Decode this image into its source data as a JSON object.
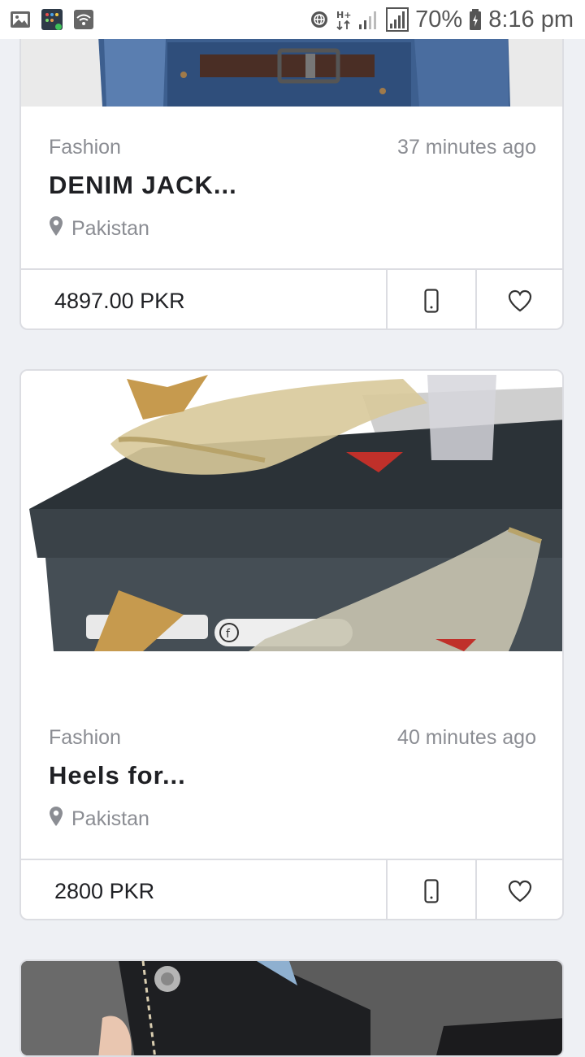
{
  "status_bar": {
    "battery": "70%",
    "time": "8:16 pm",
    "network": "H+"
  },
  "listings": [
    {
      "category": "Fashion",
      "time_ago": "37 minutes ago",
      "title": "DENIM JACK...",
      "location": "Pakistan",
      "price": "4897.00 PKR"
    },
    {
      "category": "Fashion",
      "time_ago": "40 minutes ago",
      "title": "Heels for...",
      "location": "Pakistan",
      "price": "2800 PKR"
    }
  ],
  "colors": {
    "background": "#eef0f4",
    "card": "#ffffff",
    "border": "#dcdde2",
    "muted_text": "#8b8d93",
    "title_text": "#1f2024"
  }
}
